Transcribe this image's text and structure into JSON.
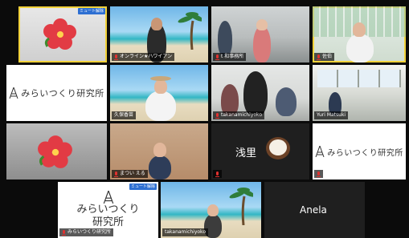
{
  "tiles": [
    {
      "id": "hibiscus-top",
      "label": "",
      "badge": "ミュート解除"
    },
    {
      "id": "online-hawaiian",
      "label": "オンライン★ハワイアン"
    },
    {
      "id": "office-raise",
      "label": "t 和事務所"
    },
    {
      "id": "green-tiles",
      "label": "佐伯"
    },
    {
      "id": "logo-1",
      "label": ""
    },
    {
      "id": "kubo",
      "label": "久保香苗"
    },
    {
      "id": "takanami",
      "label": "takanamichiyoko"
    },
    {
      "id": "yuri",
      "label": "Yuri Matsuki"
    },
    {
      "id": "hibiscus-2",
      "label": ""
    },
    {
      "id": "matsuibana",
      "label": "まつい える"
    },
    {
      "id": "asari",
      "label": "",
      "name": "浅里"
    },
    {
      "id": "logo-2",
      "label": ""
    },
    {
      "id": "logo-3",
      "label": "みらいつくり研究所",
      "badge": "ミュート解除"
    },
    {
      "id": "takanami-2",
      "label": "takanamichiyoko"
    },
    {
      "id": "anela",
      "label": "",
      "name": "Anela"
    }
  ],
  "logo": {
    "text": "みらいつくり研究所",
    "line1": "みらいつくり",
    "line2": "研究所"
  },
  "colors": {
    "active_border": "#f2d23a",
    "mute_badge": "#2d6fd2",
    "mic_muted": "#e0312f"
  }
}
